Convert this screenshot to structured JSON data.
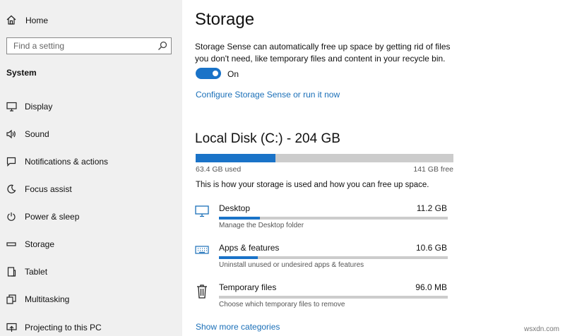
{
  "sidebar": {
    "home_label": "Home",
    "search_placeholder": "Find a setting",
    "section_title": "System",
    "items": [
      {
        "label": "Display",
        "icon": "display-icon"
      },
      {
        "label": "Sound",
        "icon": "sound-icon"
      },
      {
        "label": "Notifications & actions",
        "icon": "notifications-icon"
      },
      {
        "label": "Focus assist",
        "icon": "focus-assist-icon"
      },
      {
        "label": "Power & sleep",
        "icon": "power-icon"
      },
      {
        "label": "Storage",
        "icon": "storage-icon"
      },
      {
        "label": "Tablet",
        "icon": "tablet-icon"
      },
      {
        "label": "Multitasking",
        "icon": "multitasking-icon"
      },
      {
        "label": "Projecting to this PC",
        "icon": "projecting-icon"
      }
    ]
  },
  "main": {
    "title": "Storage",
    "description": "Storage Sense can automatically free up space by getting rid of files you don't need, like temporary files and content in your recycle bin.",
    "toggle_state": "On",
    "configure_link": "Configure Storage Sense or run it now",
    "disk": {
      "title": "Local Disk (C:) - 204 GB",
      "used_label": "63.4 GB used",
      "free_label": "141 GB free",
      "used_fraction": 0.31
    },
    "usage_info": "This is how your storage is used and how you can free up space.",
    "categories": [
      {
        "name": "Desktop",
        "size": "11.2 GB",
        "sub": "Manage the Desktop folder",
        "fraction": 0.18,
        "icon": "desktop-icon"
      },
      {
        "name": "Apps & features",
        "size": "10.6 GB",
        "sub": "Uninstall unused or undesired apps & features",
        "fraction": 0.17,
        "icon": "keyboard-icon"
      },
      {
        "name": "Temporary files",
        "size": "96.0 MB",
        "sub": "Choose which temporary files to remove",
        "fraction": 0.0,
        "icon": "trash-icon"
      }
    ],
    "show_more": "Show more categories"
  },
  "watermark": "wsxdn.com",
  "colors": {
    "accent": "#1a73c8",
    "link": "#1a6fb8",
    "sidebar_bg": "#f0f0f0",
    "bar_bg": "#cccccc"
  }
}
